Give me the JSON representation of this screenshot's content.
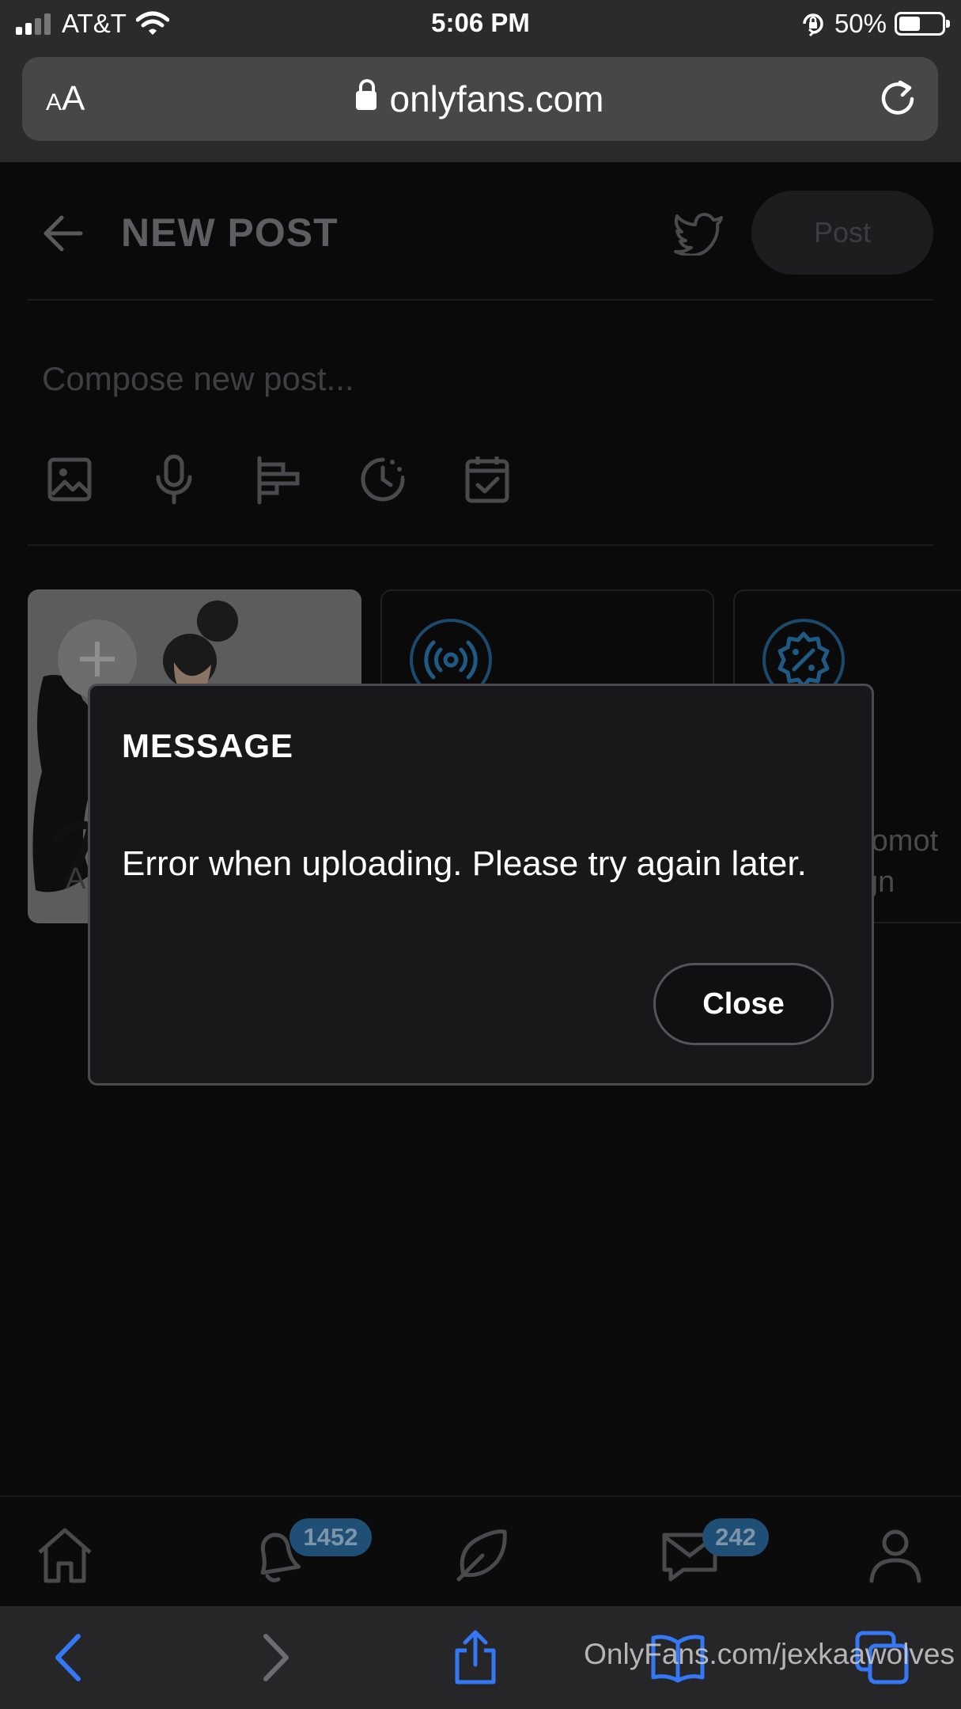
{
  "status_bar": {
    "carrier": "AT&T",
    "time": "5:06 PM",
    "battery": "50%",
    "battery_level": 0.5,
    "icons": [
      "signal-icon",
      "wifi-icon",
      "rotation-lock-icon",
      "battery-icon"
    ]
  },
  "browser": {
    "text_size_label": "AA",
    "url": "onlyfans.com",
    "icons": [
      "lock-icon",
      "reload-icon"
    ]
  },
  "header": {
    "title": "NEW POST",
    "post_label": "Post",
    "icons": [
      "back-arrow-icon",
      "twitter-icon"
    ]
  },
  "composer": {
    "placeholder": "Compose new post...",
    "tools": [
      "image-icon",
      "microphone-icon",
      "poll-icon",
      "timer-icon",
      "calendar-icon"
    ]
  },
  "cards": {
    "card1_partial_text": "A",
    "card3_partial_text_line1": "romot",
    "card3_partial_text_line2": "gn",
    "icons": [
      "plus-icon",
      "broadcast-icon",
      "discount-badge-icon"
    ]
  },
  "modal": {
    "title": "MESSAGE",
    "message": "Error when uploading. Please try again later.",
    "close_label": "Close"
  },
  "app_nav": {
    "notifications_badge": "1452",
    "messages_badge": "242",
    "icons": [
      "home-icon",
      "bell-icon",
      "feather-icon",
      "messages-icon",
      "profile-icon"
    ]
  },
  "safari_toolbar": {
    "icons": [
      "back-icon",
      "forward-icon",
      "share-icon",
      "bookmarks-icon",
      "tabs-icon"
    ]
  },
  "watermark": "OnlyFans.com/jexkaawolves",
  "colors": {
    "background": "#0a0a0b",
    "modal_bg": "#18181b",
    "accent_blue": "#2a6f9e",
    "safari_blue": "#3478f6"
  }
}
